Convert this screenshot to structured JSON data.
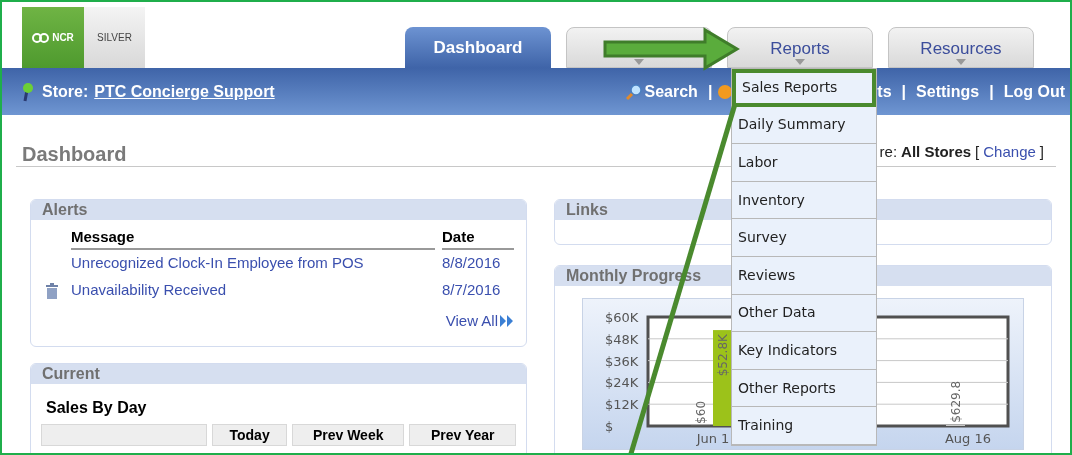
{
  "logo": {
    "brand": "NCR",
    "product": "SILVER"
  },
  "tabs": [
    {
      "label": "Dashboard",
      "selected": true,
      "has_menu": false
    },
    {
      "selected": false,
      "has_menu": true
    },
    {
      "label": "Reports",
      "selected": false,
      "has_menu": true
    },
    {
      "label": "Resources",
      "selected": false,
      "has_menu": true
    }
  ],
  "store_bar": {
    "prefix": "Store:",
    "store": "PTC Concierge Support",
    "links": [
      {
        "kind": "search",
        "label": "Search"
      },
      {
        "kind": "alerts",
        "label": "ts",
        "divider": "|"
      },
      {
        "kind": "plain",
        "label": "Settings",
        "divider": "|"
      },
      {
        "kind": "plain",
        "label": "Log Out",
        "divider": "|"
      }
    ]
  },
  "reports_menu": {
    "items": [
      {
        "label": "Sales Reports",
        "highlighted": true
      },
      {
        "label": "Daily Summary",
        "highlighted": false
      },
      {
        "label": "Labor",
        "highlighted": false
      },
      {
        "label": "Inventory",
        "highlighted": false
      },
      {
        "label": "Survey",
        "highlighted": false
      },
      {
        "label": "Reviews",
        "highlighted": false
      },
      {
        "label": "Other Data",
        "highlighted": false
      },
      {
        "label": "Key Indicators",
        "highlighted": false
      },
      {
        "label": "Other Reports",
        "highlighted": false
      },
      {
        "label": "Training",
        "highlighted": false
      }
    ]
  },
  "page_title": "Dashboard",
  "store_filter": {
    "label": "re:",
    "value": "All Stores",
    "open_bracket": "[",
    "action": "Change",
    "close_bracket": "]"
  },
  "alerts": {
    "title": "Alerts",
    "columns": [
      "Message",
      "Date"
    ],
    "rows": [
      {
        "message": "Unrecognized Clock-In Employee from POS",
        "date": "8/8/2016",
        "deletable": false
      },
      {
        "message": "Unavailability Received",
        "date": "8/7/2016",
        "deletable": true
      }
    ],
    "view_all": "View All"
  },
  "current": {
    "title": "Current",
    "subtitle": "Sales By Day",
    "columns": [
      "Today",
      "Prev Week",
      "Prev Year"
    ]
  },
  "links": {
    "title": "Links"
  },
  "monthly_progress": {
    "title": "Monthly Progress",
    "chart_data": {
      "type": "bar",
      "categories": [
        "Jun 1",
        "Aug 16"
      ],
      "series": [
        {
          "color": "#c8c8c8",
          "values": [
            60,
            629.8
          ],
          "value_labels": [
            "$60",
            "$629.8"
          ]
        },
        {
          "color": "#9cc21a",
          "values": [
            52800,
            null
          ],
          "value_labels": [
            "$52.8K",
            null
          ]
        }
      ],
      "ylim": [
        0,
        60000
      ],
      "grid": true,
      "yticks": [
        {
          "value": 0,
          "label": "$"
        },
        {
          "value": 12000,
          "label": "$12K"
        },
        {
          "value": 24000,
          "label": "$24K"
        },
        {
          "value": 36000,
          "label": "$36K"
        },
        {
          "value": 48000,
          "label": "$48K"
        },
        {
          "value": 60000,
          "label": "$60K"
        }
      ]
    }
  }
}
